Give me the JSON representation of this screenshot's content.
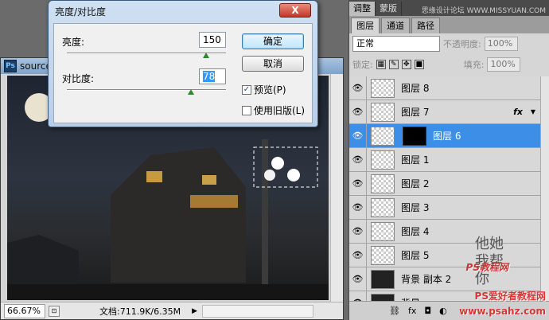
{
  "document": {
    "title": "source",
    "zoom": "66.67%",
    "info": "文档:711.9K/6.35M"
  },
  "dialog": {
    "title": "亮度/对比度",
    "close": "X",
    "brightness_label": "亮度:",
    "brightness_value": "150",
    "brightness_level": 0.875,
    "contrast_label": "对比度:",
    "contrast_value": "78",
    "contrast_level": 0.78,
    "ok": "确定",
    "cancel": "取消",
    "preview_label": "预览(P)",
    "legacy_label": "使用旧版(L)",
    "preview_checked": true,
    "legacy_checked": false
  },
  "panel": {
    "top_tabs": [
      "调整",
      "蒙版"
    ],
    "watermark_top": "思缘设计论坛 WWW.MISSYUAN.COM",
    "sub_tabs": [
      "图层",
      "通道",
      "路径"
    ],
    "blend_mode": "正常",
    "opacity_label": "不透明度:",
    "opacity_value": "100%",
    "lock_label": "锁定:",
    "fill_label": "填充:",
    "fill_value": "100%",
    "layers": [
      {
        "name": "图层 8"
      },
      {
        "name": "图层 7",
        "fx": "fx"
      },
      {
        "name": "图层 6"
      },
      {
        "name": "图层 1"
      },
      {
        "name": "图层 2"
      },
      {
        "name": "图层 3"
      },
      {
        "name": "图层 4"
      },
      {
        "name": "图层 5"
      },
      {
        "name": "背景 副本 2"
      },
      {
        "name": "背景"
      }
    ],
    "calligraphy": "他她我帮你",
    "seal": "PS",
    "watermark_mid": "PS教程网",
    "watermark_bottom_1": "PS爱好者教程网",
    "watermark_bottom_2": "www.psahz.com"
  }
}
